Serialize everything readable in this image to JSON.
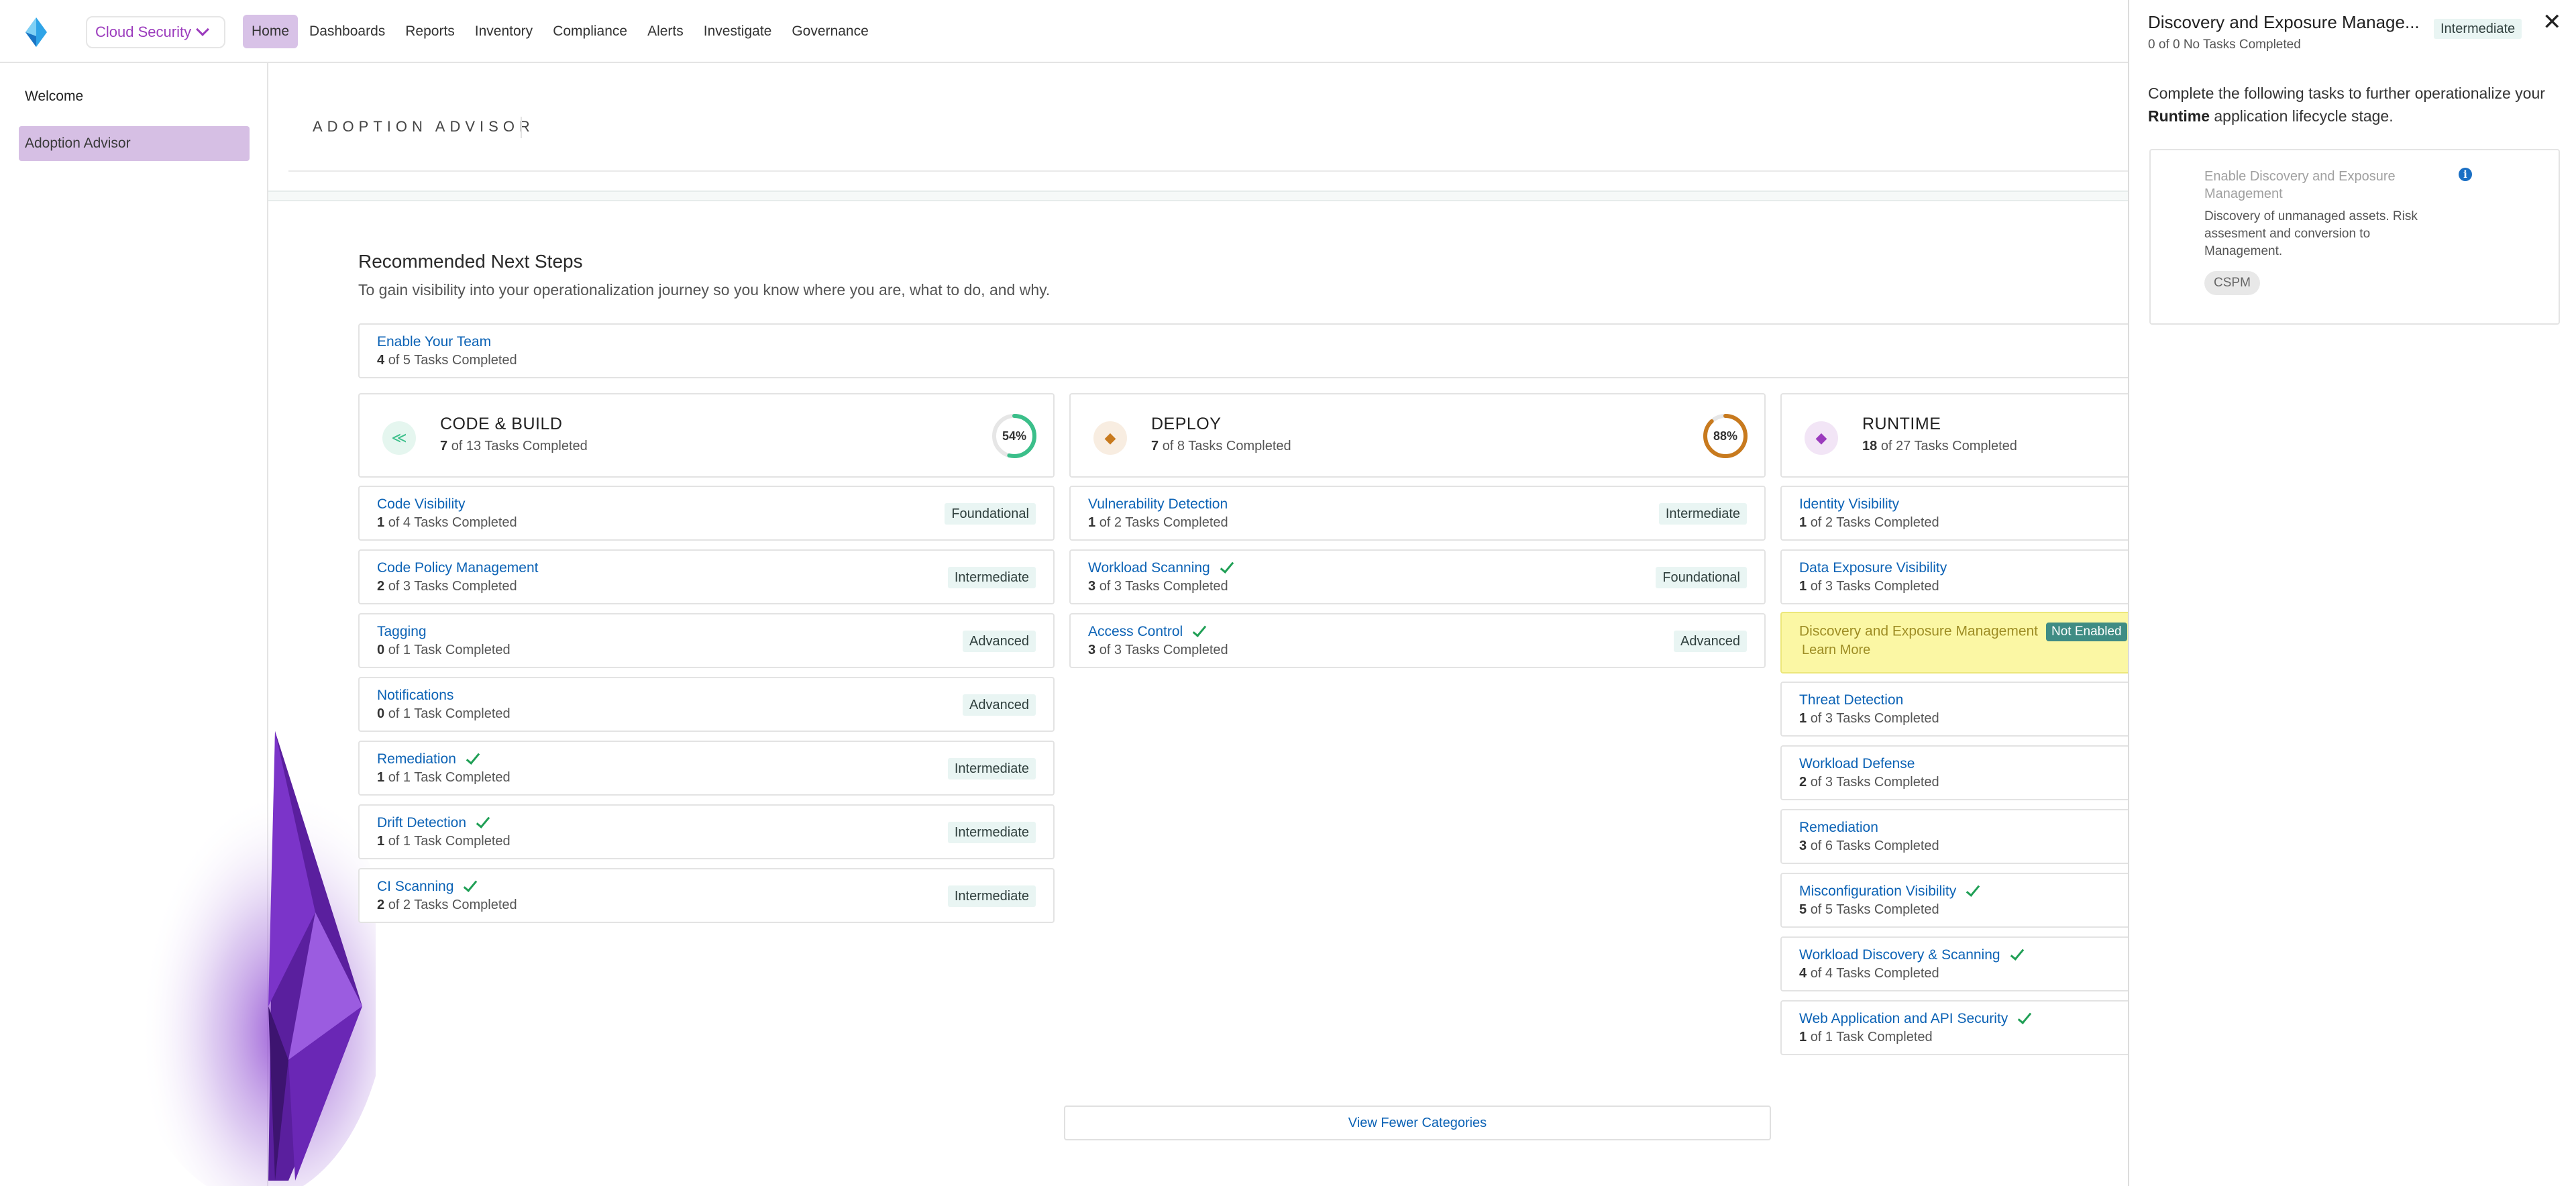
{
  "brand": {
    "product_scope": "Cloud Security"
  },
  "nav": {
    "items": [
      "Home",
      "Dashboards",
      "Reports",
      "Inventory",
      "Compliance",
      "Alerts",
      "Investigate",
      "Governance"
    ],
    "active": "Home"
  },
  "sidebar": {
    "items": [
      {
        "label": "Welcome"
      },
      {
        "label": "Adoption Advisor",
        "selected": true
      }
    ]
  },
  "main": {
    "page_title": "ADOPTION ADVISOR",
    "section_title": "Recommended Next Steps",
    "section_subtitle": "To gain visibility into your operationalization journey so you know where you are, what to do, and why.",
    "team": {
      "title": "Enable Your Team",
      "done": "4",
      "rest": "of 5 Tasks Completed"
    },
    "stages": [
      {
        "name": "CODE & BUILD",
        "done": "7",
        "rest": "of 13 Tasks Completed",
        "percent_label": "54%",
        "percent": 0.54,
        "color": "#3bbf8a"
      },
      {
        "name": "DEPLOY",
        "done": "7",
        "rest": "of 8 Tasks Completed",
        "percent_label": "88%",
        "percent": 0.88,
        "color": "#c87a1e"
      },
      {
        "name": "RUNTIME",
        "done": "18",
        "rest": "of 27 Tasks Completed",
        "color": "#9b3bbd"
      }
    ],
    "code_build_tasks": [
      {
        "title": "Code Visibility",
        "done": "1",
        "rest": "of 4 Tasks Completed",
        "level": "Foundational",
        "complete": false
      },
      {
        "title": "Code Policy Management",
        "done": "2",
        "rest": "of 3 Tasks Completed",
        "level": "Intermediate",
        "complete": false
      },
      {
        "title": "Tagging",
        "done": "0",
        "rest": "of 1 Task Completed",
        "level": "Advanced",
        "complete": false
      },
      {
        "title": "Notifications",
        "done": "0",
        "rest": "of 1 Task Completed",
        "level": "Advanced",
        "complete": false
      },
      {
        "title": "Remediation",
        "done": "1",
        "rest": "of 1 Task Completed",
        "level": "Intermediate",
        "complete": true
      },
      {
        "title": "Drift Detection",
        "done": "1",
        "rest": "of 1 Task Completed",
        "level": "Intermediate",
        "complete": true
      },
      {
        "title": "CI Scanning",
        "done": "2",
        "rest": "of 2 Tasks Completed",
        "level": "Intermediate",
        "complete": true
      }
    ],
    "deploy_tasks": [
      {
        "title": "Vulnerability Detection",
        "done": "1",
        "rest": "of 2 Tasks Completed",
        "level": "Intermediate",
        "complete": false
      },
      {
        "title": "Workload Scanning",
        "done": "3",
        "rest": "of 3 Tasks Completed",
        "level": "Foundational",
        "complete": true
      },
      {
        "title": "Access Control",
        "done": "3",
        "rest": "of 3 Tasks Completed",
        "level": "Advanced",
        "complete": true
      }
    ],
    "runtime_tasks": [
      {
        "title": "Identity Visibility",
        "done": "1",
        "rest": "of 2 Tasks Completed",
        "complete": false
      },
      {
        "title": "Data Exposure Visibility",
        "done": "1",
        "rest": "of 3 Tasks Completed",
        "complete": false
      },
      {
        "title": "Discovery and Exposure Management",
        "status": "Not Enabled",
        "learn_more": "Learn More",
        "highlighted": true
      },
      {
        "title": "Threat Detection",
        "done": "1",
        "rest": "of 3 Tasks Completed",
        "complete": false
      },
      {
        "title": "Workload Defense",
        "done": "2",
        "rest": "of 3 Tasks Completed",
        "complete": false
      },
      {
        "title": "Remediation",
        "done": "3",
        "rest": "of 6 Tasks Completed",
        "complete": false
      },
      {
        "title": "Misconfiguration Visibility",
        "done": "5",
        "rest": "of 5 Tasks Completed",
        "complete": true
      },
      {
        "title": "Workload Discovery & Scanning",
        "done": "4",
        "rest": "of 4 Tasks Completed",
        "complete": true
      },
      {
        "title": "Web Application and API Security",
        "done": "1",
        "rest": "of 1 Task Completed",
        "complete": true
      }
    ],
    "view_fewer": "View Fewer Categories"
  },
  "panel": {
    "title": "Discovery and Exposure Manage...",
    "level": "Intermediate",
    "close": "✕",
    "subtitle": "0 of 0 No Tasks Completed",
    "desc_before": "Complete the following tasks to further operationalize your",
    "desc_bold": "Runtime",
    "desc_after": "application lifecycle stage.",
    "task": {
      "title": "Enable Discovery and Exposure Management",
      "info": "i",
      "description": "Discovery of unmanaged assets. Risk assesment and conversion to Management.",
      "tag": "CSPM"
    }
  }
}
